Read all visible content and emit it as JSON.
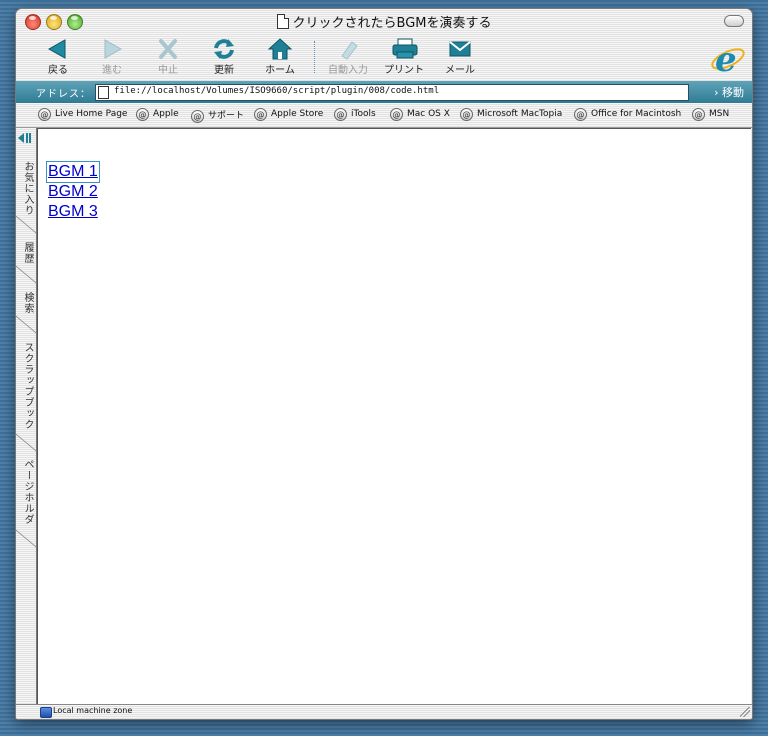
{
  "window": {
    "title": "クリックされたらBGMを演奏する"
  },
  "toolbar": {
    "buttons": [
      {
        "id": "back",
        "label": "戻る",
        "enabled": true
      },
      {
        "id": "forward",
        "label": "進む",
        "enabled": false
      },
      {
        "id": "stop",
        "label": "中止",
        "enabled": false
      },
      {
        "id": "refresh",
        "label": "更新",
        "enabled": true
      },
      {
        "id": "home",
        "label": "ホーム",
        "enabled": true
      },
      {
        "id": "autofill",
        "label": "自動入力",
        "enabled": false
      },
      {
        "id": "print",
        "label": "プリント",
        "enabled": true
      },
      {
        "id": "mail",
        "label": "メール",
        "enabled": true
      }
    ]
  },
  "address": {
    "label": "アドレス：",
    "url": "file://localhost/Volumes/ISO9660/script/plugin/008/code.html",
    "go_label": "移動"
  },
  "favorites": [
    "Live Home Page",
    "Apple",
    "サポート",
    "Apple Store",
    "iTools",
    "Mac OS X",
    "Microsoft MacTopia",
    "Office for Macintosh",
    "MSN"
  ],
  "sidebar": {
    "tabs": [
      "お気に入り",
      "履歴",
      "検索",
      "スクラップブック",
      "ページホルダ"
    ]
  },
  "content": {
    "links": [
      "BGM 1",
      "BGM 2",
      "BGM 3"
    ]
  },
  "status": {
    "text": "Local machine zone"
  },
  "colors": {
    "accent": "#1f8aa0",
    "link": "#0000cc",
    "desktop": "#3f6f98"
  }
}
